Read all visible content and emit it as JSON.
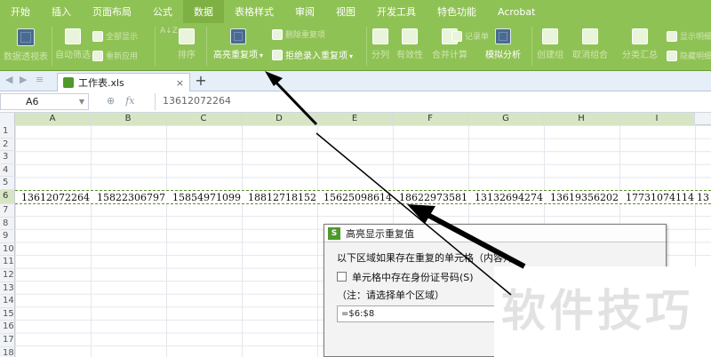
{
  "menu": {
    "items": [
      "开始",
      "插入",
      "页面布局",
      "公式",
      "数据",
      "表格样式",
      "审阅",
      "视图",
      "开发工具",
      "特色功能",
      "Acrobat"
    ],
    "active_index": 4
  },
  "ribbon": {
    "pivot": "数据透视表",
    "autofilter": "自动筛选",
    "show_all": "全部显示",
    "reapply": "重新应用",
    "sort_az": "A↓Z",
    "sort": "排序",
    "highlight_dup": "高亮重复项",
    "remove_dup": "删除重复项",
    "reject_dup": "拒绝录入重复项",
    "split": "分列",
    "validity": "有效性",
    "merge_calc": "合并计算",
    "record_sheet": "记录单",
    "simulate": "模拟分析",
    "create_group": "创建组",
    "ungroup": "取消组合",
    "subtotal": "分类汇总",
    "show_detail": "显示明细",
    "hide_detail": "隐藏明细"
  },
  "tab": {
    "filename": "工作表.xls"
  },
  "formula_bar": {
    "cell_ref": "A6",
    "fx": "fx",
    "value": "13612072264"
  },
  "sheet": {
    "columns": [
      "A",
      "B",
      "C",
      "D",
      "E",
      "F",
      "G",
      "H",
      "I"
    ],
    "rows": [
      "1",
      "2",
      "3",
      "4",
      "5",
      "6",
      "7",
      "8",
      "9",
      "10",
      "11",
      "12",
      "13",
      "14",
      "15",
      "16",
      "17",
      "18"
    ],
    "selected_row": "6",
    "row6_values": [
      "13612072264",
      "15822306797",
      "15854971099",
      "18812718152",
      "15625098614",
      "18622973581",
      "13132694274",
      "13619356202",
      "17731074114",
      "13"
    ]
  },
  "dialog": {
    "title": "高亮显示重复值",
    "line1": "以下区域如果存在重复的单元格（内容），",
    "checkbox_label": "单元格中存在身份证号码",
    "checkbox_shortcut": "(S)",
    "note": "（注：请选择单个区域）",
    "range_value": "=$6:$8"
  },
  "watermark": "软件技巧",
  "colors": {
    "ribbon_green": "#8fc254",
    "selection_green": "#d7e5c4",
    "arrow": "#000000"
  }
}
